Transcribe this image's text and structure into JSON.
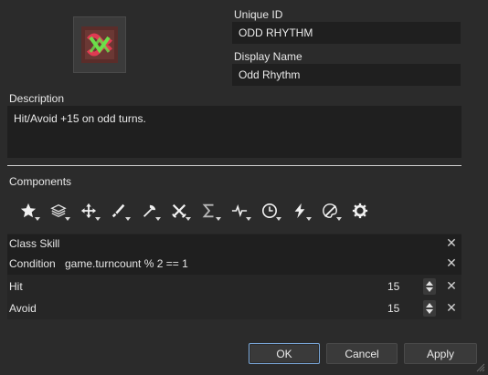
{
  "icon_name": "odd-rhythm-skill-icon",
  "unique_id": {
    "label": "Unique ID",
    "value": "ODD RHYTHM"
  },
  "display_name": {
    "label": "Display Name",
    "value": "Odd Rhythm"
  },
  "description": {
    "label": "Description",
    "value": "Hit/Avoid +15 on odd turns."
  },
  "components": {
    "label": "Components",
    "toolbar": [
      "star-icon",
      "layers-icon",
      "move-icon",
      "sword-icon",
      "axe-icon",
      "crossed-swords-icon",
      "sigma-icon",
      "pulse-icon",
      "clock-icon",
      "lightning-icon",
      "palette-icon",
      "gear-icon"
    ],
    "rows": {
      "class_skill": "Class Skill",
      "condition_label": "Condition",
      "condition_value": "game.turncount % 2 == 1",
      "hit_label": "Hit",
      "hit_value": "15",
      "avoid_label": "Avoid",
      "avoid_value": "15"
    }
  },
  "buttons": {
    "ok": "OK",
    "cancel": "Cancel",
    "apply": "Apply"
  }
}
